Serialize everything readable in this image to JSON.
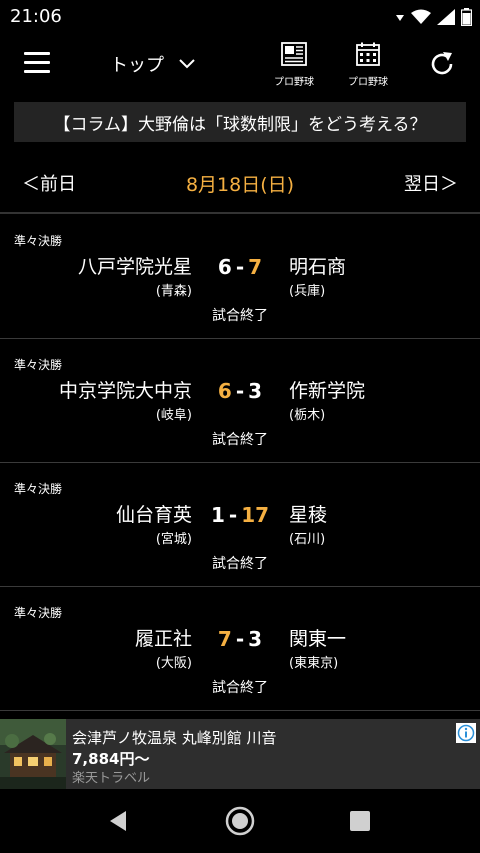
{
  "status_bar": {
    "time": "21:06"
  },
  "app_bar": {
    "top_label": "トップ",
    "action_news_label": "プロ野球",
    "action_schedule_label": "プロ野球"
  },
  "banner": {
    "text": "【コラム】大野倫は「球数制限」をどう考える？"
  },
  "date_nav": {
    "prev": "＜前日",
    "current": "8月18日(日)",
    "next": "翌日＞"
  },
  "games": [
    {
      "round": "準々決勝",
      "home": "八戸学院光星",
      "home_pref": "(青森)",
      "home_score": "6",
      "away": "明石商",
      "away_pref": "(兵庫)",
      "away_score": "7",
      "status": "試合終了"
    },
    {
      "round": "準々決勝",
      "home": "中京学院大中京",
      "home_pref": "(岐阜)",
      "home_score": "6",
      "away": "作新学院",
      "away_pref": "(栃木)",
      "away_score": "3",
      "status": "試合終了"
    },
    {
      "round": "準々決勝",
      "home": "仙台育英",
      "home_pref": "(宮城)",
      "home_score": "1",
      "away": "星稜",
      "away_pref": "(石川)",
      "away_score": "17",
      "status": "試合終了"
    },
    {
      "round": "準々決勝",
      "home": "履正社",
      "home_pref": "(大阪)",
      "home_score": "7",
      "away": "関東一",
      "away_pref": "(東東京)",
      "away_score": "3",
      "status": "試合終了"
    }
  ],
  "score_dash": "-",
  "ad": {
    "title": "会津芦ノ牧温泉 丸峰別館 川音",
    "price": "7,884円〜",
    "source": "楽天トラベル"
  },
  "colors": {
    "accent": "#f5b042",
    "background": "#000000",
    "banner_bg": "#242424",
    "ad_bg": "#2e2e2e"
  }
}
